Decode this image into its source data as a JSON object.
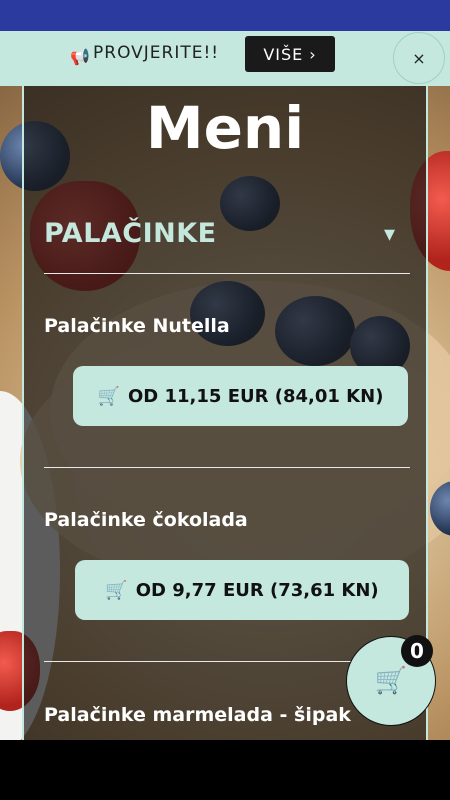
{
  "banner": {
    "icon": "megaphone-icon",
    "icon_glyph": "📢",
    "text": "PROVJERITE!!",
    "button_label": "VIŠE",
    "button_icon_glyph": "›",
    "close_glyph": "×"
  },
  "menu": {
    "title": "Meni",
    "category": {
      "name": "PALAČINKE",
      "icon_glyph": "▾"
    },
    "items": [
      {
        "name": "Palačinke Nutella",
        "price": "OD 11,15 EUR (84,01 KN)"
      },
      {
        "name": "Palačinke čokolada",
        "price": "OD 9,77 EUR (73,61 KN)"
      },
      {
        "name": "Palačinke marmelada - šipak"
      }
    ],
    "price_icon_glyph": "🛒"
  },
  "cart": {
    "icon_glyph": "🛒",
    "count": "0"
  },
  "colors": {
    "accent": "#c4e8de",
    "statusbar": "#2b3a9e",
    "overlay": "#1e1e1e"
  }
}
